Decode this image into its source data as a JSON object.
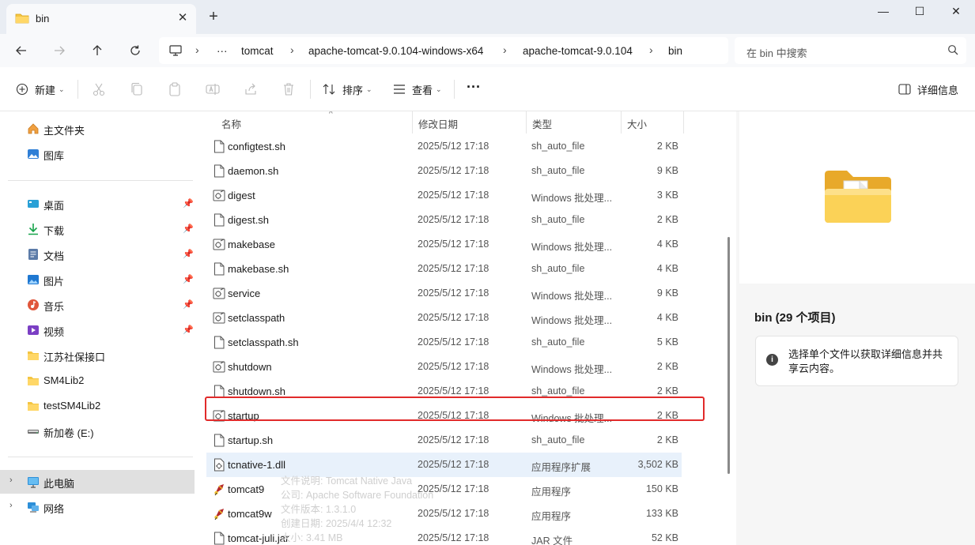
{
  "window": {
    "tab_title": "bin",
    "close_tab": "✕",
    "new_tab": "+",
    "minimize": "—",
    "maximize": "☐",
    "close": "✕"
  },
  "address": {
    "more": "···",
    "breadcrumbs": [
      "tomcat",
      "apache-tomcat-9.0.104-windows-x64",
      "apache-tomcat-9.0.104",
      "bin"
    ],
    "search_placeholder": "在 bin 中搜索"
  },
  "toolbar": {
    "new_label": "新建",
    "sort_label": "排序",
    "view_label": "查看",
    "more_label": "···",
    "details_label": "详细信息"
  },
  "sidebar": {
    "items": [
      {
        "label": "主文件夹",
        "icon": "home-icon"
      },
      {
        "label": "图库",
        "icon": "gallery-icon"
      },
      {
        "label": "桌面",
        "icon": "desktop-icon",
        "pinned": true
      },
      {
        "label": "下载",
        "icon": "download-icon",
        "pinned": true
      },
      {
        "label": "文档",
        "icon": "document-icon",
        "pinned": true
      },
      {
        "label": "图片",
        "icon": "pictures-icon",
        "pinned": true
      },
      {
        "label": "音乐",
        "icon": "music-icon",
        "pinned": true
      },
      {
        "label": "视频",
        "icon": "video-icon",
        "pinned": true
      },
      {
        "label": "江苏社保接口",
        "icon": "folder-icon"
      },
      {
        "label": "SM4Lib2",
        "icon": "folder-icon"
      },
      {
        "label": "testSM4Lib2",
        "icon": "folder-icon"
      },
      {
        "label": "新加卷 (E:)",
        "icon": "drive-icon"
      },
      {
        "label": "此电脑",
        "icon": "computer-icon"
      },
      {
        "label": "网络",
        "icon": "network-icon"
      }
    ]
  },
  "columns": {
    "name": "名称",
    "date": "修改日期",
    "type": "类型",
    "size": "大小"
  },
  "files": [
    {
      "name": "configtest.sh",
      "date": "2025/5/12 17:18",
      "type": "sh_auto_file",
      "size": "2 KB",
      "kind": "file"
    },
    {
      "name": "daemon.sh",
      "date": "2025/5/12 17:18",
      "type": "sh_auto_file",
      "size": "9 KB",
      "kind": "file"
    },
    {
      "name": "digest",
      "date": "2025/5/12 17:18",
      "type": "Windows 批处理...",
      "size": "3 KB",
      "kind": "bat"
    },
    {
      "name": "digest.sh",
      "date": "2025/5/12 17:18",
      "type": "sh_auto_file",
      "size": "2 KB",
      "kind": "file"
    },
    {
      "name": "makebase",
      "date": "2025/5/12 17:18",
      "type": "Windows 批处理...",
      "size": "4 KB",
      "kind": "bat"
    },
    {
      "name": "makebase.sh",
      "date": "2025/5/12 17:18",
      "type": "sh_auto_file",
      "size": "4 KB",
      "kind": "file"
    },
    {
      "name": "service",
      "date": "2025/5/12 17:18",
      "type": "Windows 批处理...",
      "size": "9 KB",
      "kind": "bat"
    },
    {
      "name": "setclasspath",
      "date": "2025/5/12 17:18",
      "type": "Windows 批处理...",
      "size": "4 KB",
      "kind": "bat"
    },
    {
      "name": "setclasspath.sh",
      "date": "2025/5/12 17:18",
      "type": "sh_auto_file",
      "size": "5 KB",
      "kind": "file"
    },
    {
      "name": "shutdown",
      "date": "2025/5/12 17:18",
      "type": "Windows 批处理...",
      "size": "2 KB",
      "kind": "bat"
    },
    {
      "name": "shutdown.sh",
      "date": "2025/5/12 17:18",
      "type": "sh_auto_file",
      "size": "2 KB",
      "kind": "file"
    },
    {
      "name": "startup",
      "date": "2025/5/12 17:18",
      "type": "Windows 批处理...",
      "size": "2 KB",
      "kind": "bat"
    },
    {
      "name": "startup.sh",
      "date": "2025/5/12 17:18",
      "type": "sh_auto_file",
      "size": "2 KB",
      "kind": "file"
    },
    {
      "name": "tcnative-1.dll",
      "date": "2025/5/12 17:18",
      "type": "应用程序扩展",
      "size": "3,502 KB",
      "kind": "dll"
    },
    {
      "name": "tomcat9",
      "date": "2025/5/12 17:18",
      "type": "应用程序",
      "size": "150 KB",
      "kind": "exe"
    },
    {
      "name": "tomcat9w",
      "date": "2025/5/12 17:18",
      "type": "应用程序",
      "size": "133 KB",
      "kind": "exe"
    },
    {
      "name": "tomcat-juli.jar",
      "date": "2025/5/12 17:18",
      "type": "JAR 文件",
      "size": "52 KB",
      "kind": "file"
    }
  ],
  "tooltip": {
    "lines": [
      "文件说明: Tomcat Native Java",
      "公司: Apache Software Foundation",
      "文件版本: 1.3.1.0",
      "创建日期: 2025/4/4 12:32",
      "大小: 3.41 MB"
    ]
  },
  "details": {
    "title": "bin (29 个项目)",
    "message": "选择单个文件以获取详细信息并共享云内容。",
    "info_glyph": "i"
  },
  "colors": {
    "highlight_border": "#e12a2a",
    "folder_yellow": "#f4c542",
    "accent_blue": "#0067c0"
  }
}
